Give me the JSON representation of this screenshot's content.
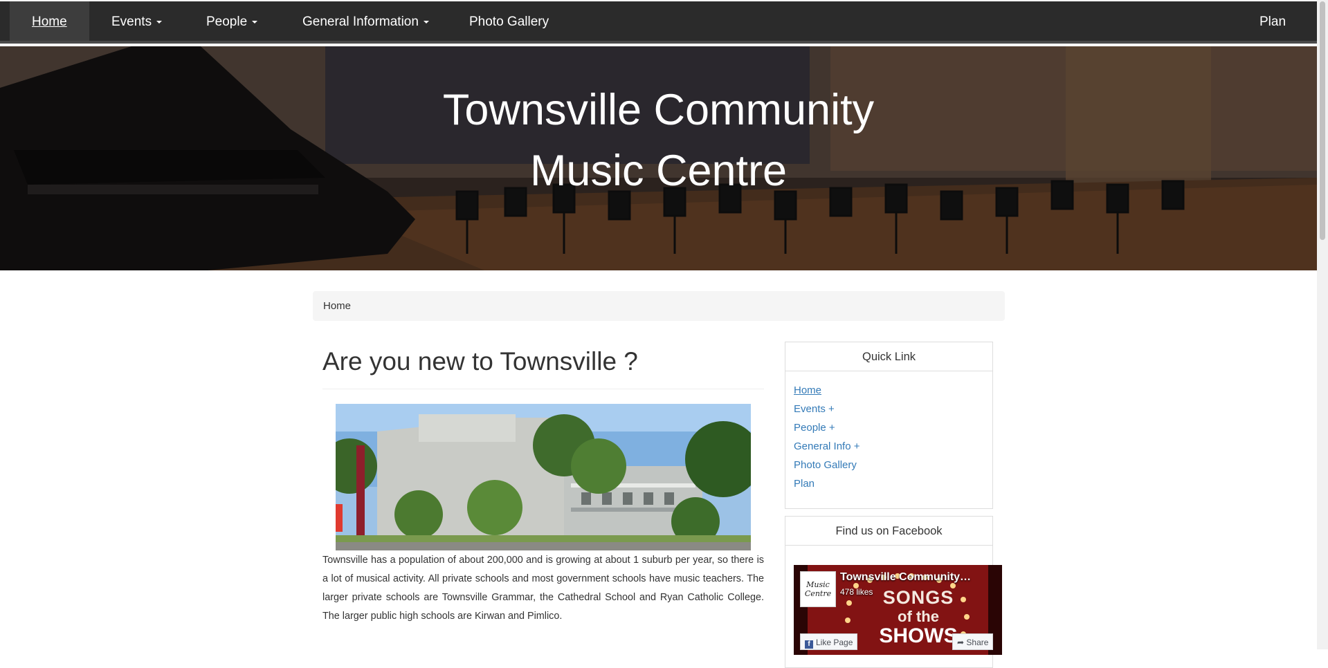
{
  "nav": {
    "home": "Home",
    "events": "Events",
    "people": "People",
    "general_information": "General Information",
    "photo_gallery": "Photo Gallery",
    "plan": "Plan"
  },
  "hero": {
    "title_line1": "Townsville Community",
    "title_line2": "Music Centre"
  },
  "breadcrumb": {
    "current": "Home"
  },
  "main": {
    "heading": "Are you new to Townsville ?",
    "intro": "Townsville has a population of about 200,000 and is growing at about 1 suburb per year, so there is a lot of musical activity. All private schools and most government schools have music teachers. The larger private schools are Townsville Grammar, the Cathedral School and Ryan Catholic College. The larger public high schools are Kirwan and Pimlico."
  },
  "quick_link": {
    "title": "Quick Link",
    "items": [
      "Home",
      "Events +",
      "People +",
      "General Info +",
      "Photo Gallery",
      "Plan"
    ]
  },
  "facebook": {
    "title": "Find us on Facebook",
    "page_name": "Townsville Community…",
    "likes": "478 likes",
    "logo_text": "Music Centre",
    "banner_line1": "SONGS",
    "banner_line2": "of the",
    "banner_line3": "SHOWS",
    "like_button": "Like Page",
    "share_button": "Share"
  },
  "colors": {
    "navbar": "#2b2b2b",
    "link": "#337ab7",
    "breadcrumb_bg": "#f5f5f5"
  }
}
